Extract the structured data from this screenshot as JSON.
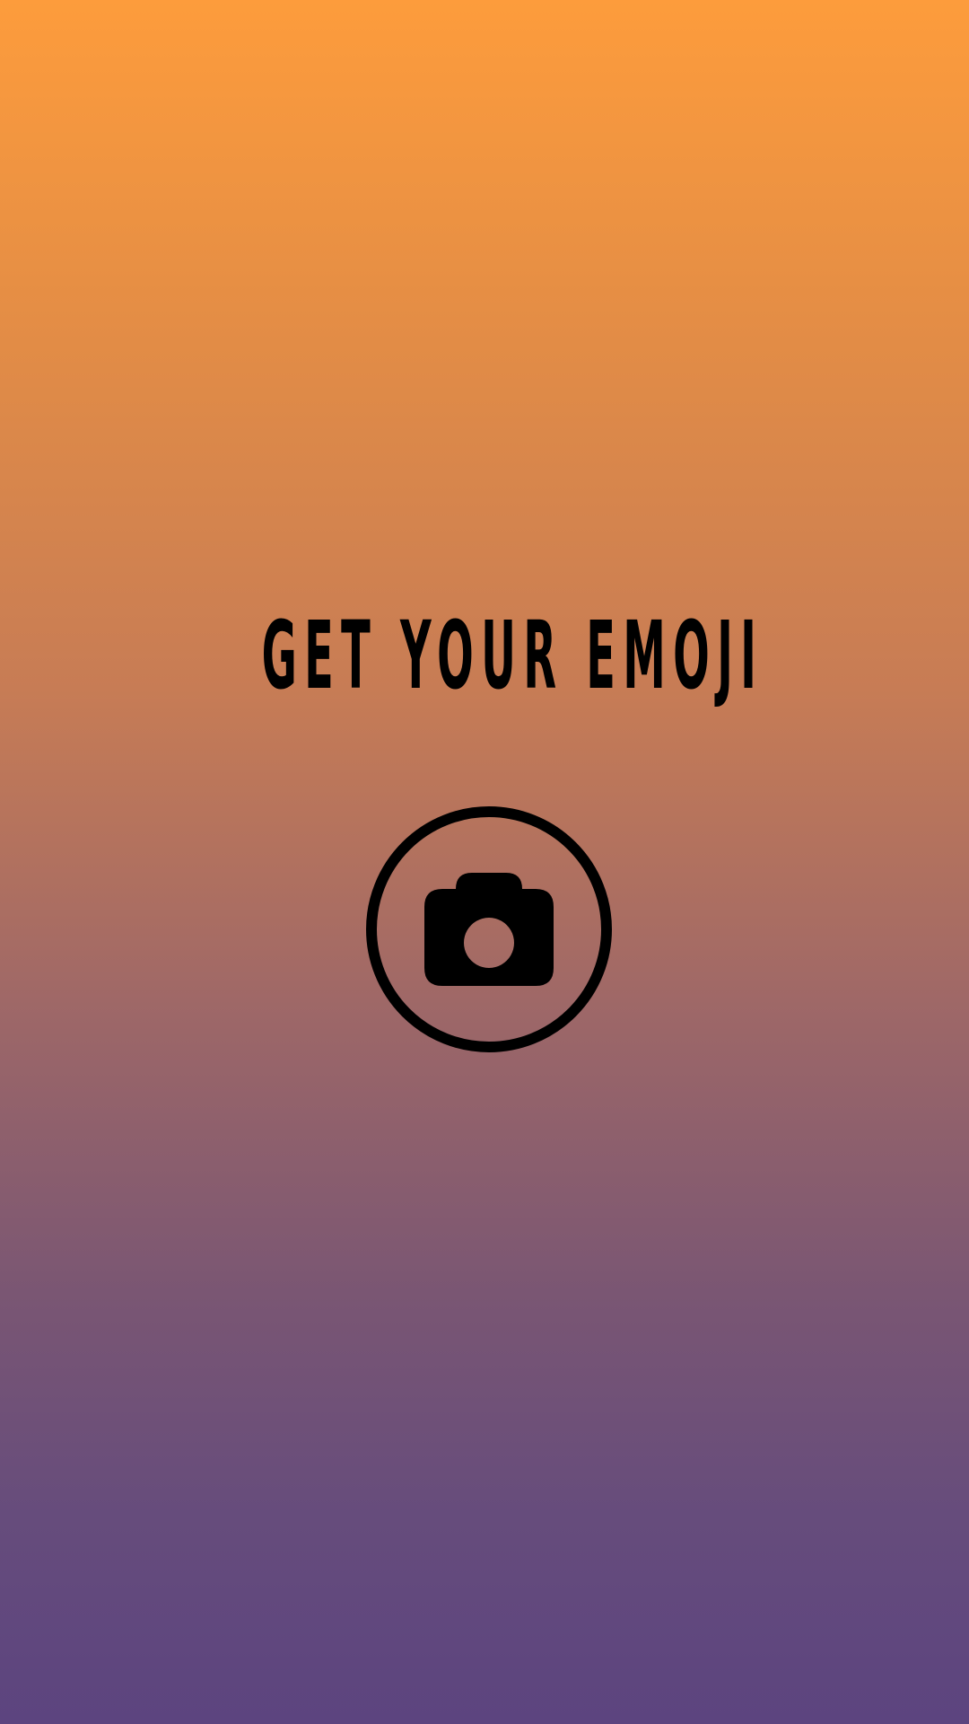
{
  "screen": {
    "title": "GET YOUR EMOJI",
    "background_gradient": [
      "#FD9C3C",
      "#C77C55",
      "#9F6867",
      "#5C447F"
    ],
    "text_color": "#000000"
  },
  "camera_button": {
    "icon": "camera-icon",
    "ring_color": "#000000"
  }
}
